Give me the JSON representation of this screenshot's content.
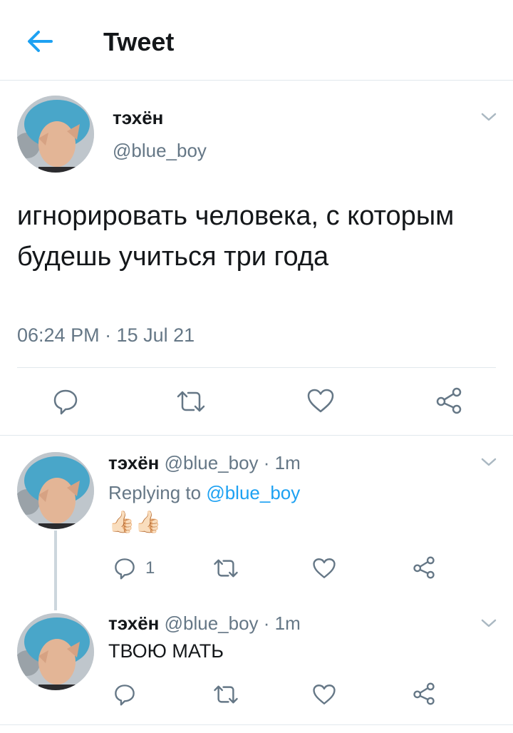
{
  "header": {
    "title": "Tweet",
    "back_icon": "arrow-left-icon",
    "accent": "#1da1f2"
  },
  "main_tweet": {
    "display_name": "тэхён",
    "handle": "@blue_boy",
    "text": "игнорировать человека, с которым будешь учиться три года",
    "timestamp": "06:24 PM · 15 Jul 21",
    "actions": [
      "reply-icon",
      "retweet-icon",
      "like-icon",
      "share-icon"
    ]
  },
  "replies": [
    {
      "display_name": "тэхён",
      "handle_time": "@blue_boy · 1m",
      "replying_prefix": "Replying to",
      "replying_to": "@blue_boy",
      "content_emoji": "👍🏻👍🏻",
      "reply_count": "1"
    },
    {
      "display_name": "тэхён",
      "handle_time": "@blue_boy · 1m",
      "text": "ТВОЮ МАТЬ"
    }
  ],
  "colors": {
    "muted": "#657786",
    "link": "#1da1f2",
    "divider": "#e1e8ed",
    "icon": "#657786"
  }
}
